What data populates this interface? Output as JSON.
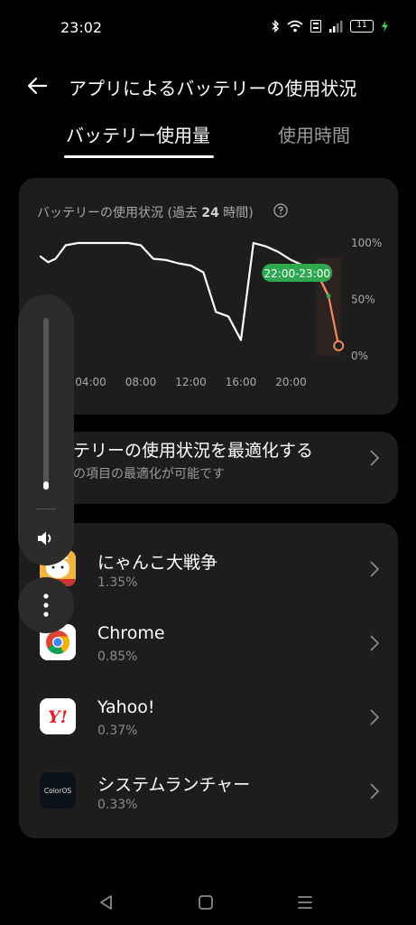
{
  "status_bar": {
    "time": "23:02",
    "battery_level": "11"
  },
  "header": {
    "title": "アプリによるバッテリーの使用状況"
  },
  "tabs": [
    {
      "label": "バッテリー使用量",
      "active": true
    },
    {
      "label": "使用時間",
      "active": false
    }
  ],
  "chart_card": {
    "title_prefix": "バッテリーの使用状況 (過去 ",
    "title_hours": "24",
    "title_suffix": " 時間)"
  },
  "chart_data": {
    "type": "line",
    "title": "バッテリーの使用状況 (過去 24 時間)",
    "x_ticks": [
      "04:00",
      "08:00",
      "12:00",
      "16:00",
      "20:00"
    ],
    "y_ticks": [
      "100%",
      "50%",
      "0%"
    ],
    "ylim": [
      0,
      100
    ],
    "xlim": [
      0,
      24
    ],
    "series": [
      {
        "points": [
          [
            0,
            88
          ],
          [
            0.6,
            83
          ],
          [
            1.2,
            86
          ],
          [
            2,
            98
          ],
          [
            3,
            100
          ],
          [
            5,
            100
          ],
          [
            7,
            100
          ],
          [
            8,
            98
          ],
          [
            9,
            86
          ],
          [
            10,
            85
          ],
          [
            11,
            82
          ],
          [
            12,
            80
          ],
          [
            13,
            74
          ],
          [
            14,
            39
          ],
          [
            15,
            35
          ],
          [
            16,
            14
          ],
          [
            17,
            100
          ],
          [
            18,
            97
          ],
          [
            19,
            92
          ],
          [
            20,
            85
          ],
          [
            21,
            80
          ],
          [
            22,
            75
          ],
          [
            23,
            53
          ]
        ],
        "color": "#ffffff"
      },
      {
        "points": [
          [
            22,
            75
          ],
          [
            23,
            53
          ],
          [
            23.8,
            9
          ]
        ],
        "color": "#f08a5d"
      }
    ],
    "highlight": {
      "label": "22:00-23:00",
      "x_range": [
        22,
        24
      ],
      "color": "#2ea84e"
    },
    "grid": false
  },
  "optimize": {
    "title": "テリーの使用状況を最適化する",
    "subtitle": "の項目の最適化が可能です"
  },
  "apps": [
    {
      "name": "にゃんこ大戦争",
      "percent": "1.35%",
      "icon": "nyanko-app-icon"
    },
    {
      "name": "Chrome",
      "percent": "0.85%",
      "icon": "chrome-app-icon"
    },
    {
      "name": "Yahoo!",
      "percent": "0.37%",
      "icon": "yahoo-app-icon",
      "icon_text": "Y!"
    },
    {
      "name": "システムランチャー",
      "percent": "0.33%",
      "icon": "coloros-app-icon",
      "icon_text": "ColorOS"
    }
  ],
  "volume": {
    "level_percent": 5
  },
  "colors": {
    "background": "#000000",
    "card": "#1d1d1d",
    "highlight_green": "#2ea84e",
    "drain_orange": "#f08a5d"
  }
}
